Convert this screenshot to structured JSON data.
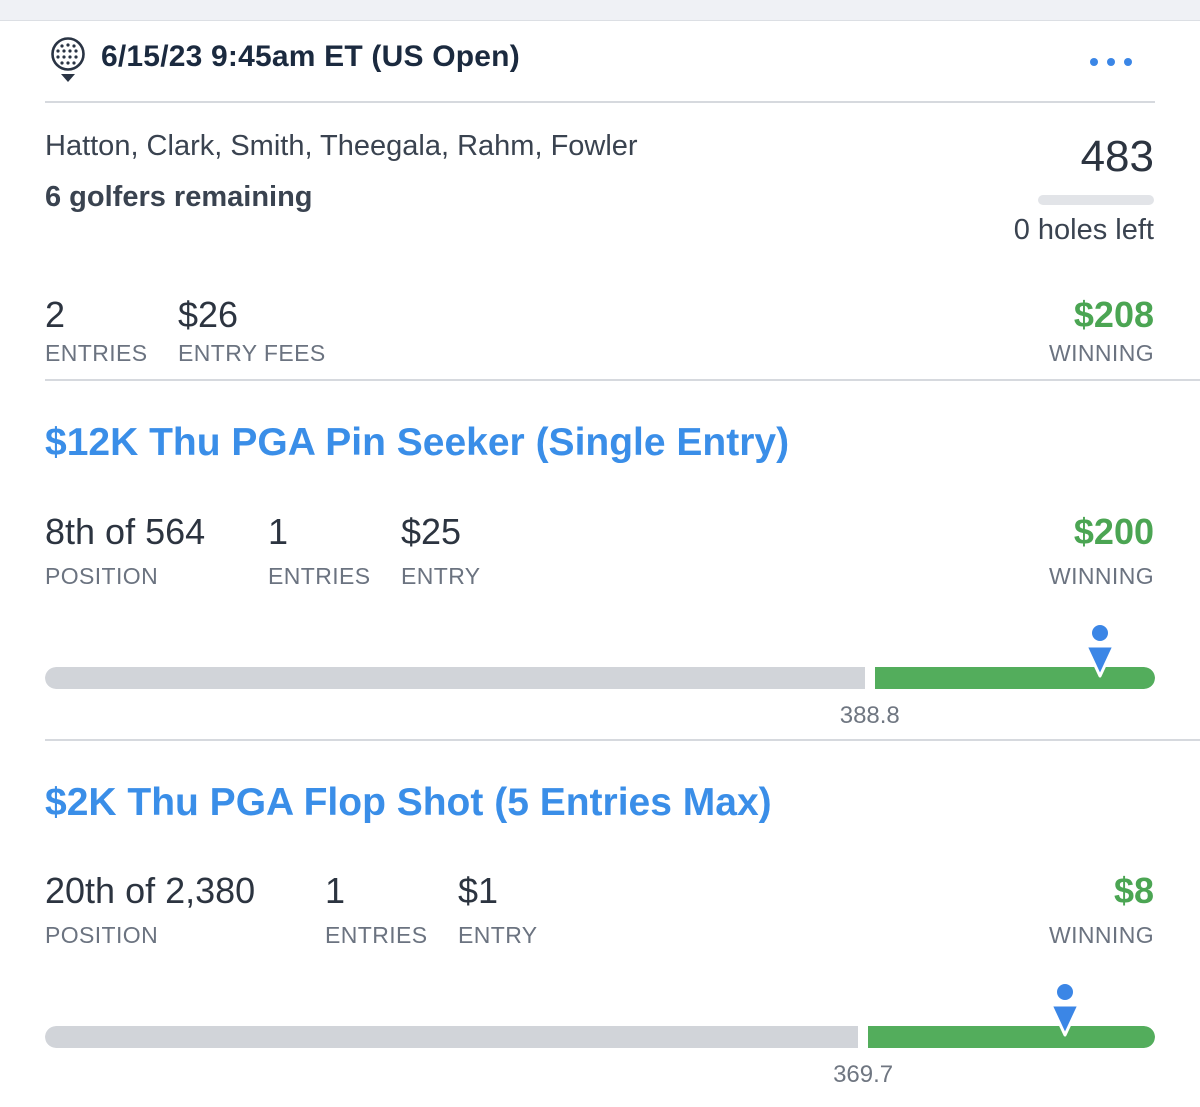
{
  "header": {
    "title": "6/15/23 9:45am ET (US Open)",
    "icon": "golf-ball-tee-icon",
    "more_icon": "more-dots-icon"
  },
  "lineup": {
    "golfers": "Hatton, Clark, Smith, Theegala, Rahm, Fowler",
    "remaining": "6 golfers remaining",
    "score": "483",
    "holes_left": "0 holes left",
    "holes_progress": 0
  },
  "summary": {
    "entries_value": "2",
    "entries_label": "ENTRIES",
    "fees_value": "$26",
    "fees_label": "ENTRY FEES",
    "winning_value": "$208",
    "winning_label": "WINNING"
  },
  "contests": [
    {
      "title": "$12K Thu PGA Pin Seeker (Single Entry)",
      "position_value": "8th of 564",
      "position_label": "POSITION",
      "entries_value": "1",
      "entries_label": "ENTRIES",
      "entry_value": "$25",
      "entry_label": "ENTRY",
      "winning_value": "$200",
      "winning_label": "WINNING",
      "cash_line": "388.8",
      "cash_line_fraction": 0.743,
      "marker_fraction": 0.95
    },
    {
      "title": "$2K Thu PGA Flop Shot (5 Entries Max)",
      "position_value": "20th of 2,380",
      "position_label": "POSITION",
      "entries_value": "1",
      "entries_label": "ENTRIES",
      "entry_value": "$1",
      "entry_label": "ENTRY",
      "winning_value": "$8",
      "winning_label": "WINNING",
      "cash_line": "369.7",
      "cash_line_fraction": 0.737,
      "marker_fraction": 0.919
    }
  ],
  "colors": {
    "accent_blue": "#3a8ee8",
    "winning_green": "#4ba553",
    "bar_green": "#53ad5c",
    "bar_gray": "#d1d4d9",
    "marker_blue": "#3b86e6"
  }
}
